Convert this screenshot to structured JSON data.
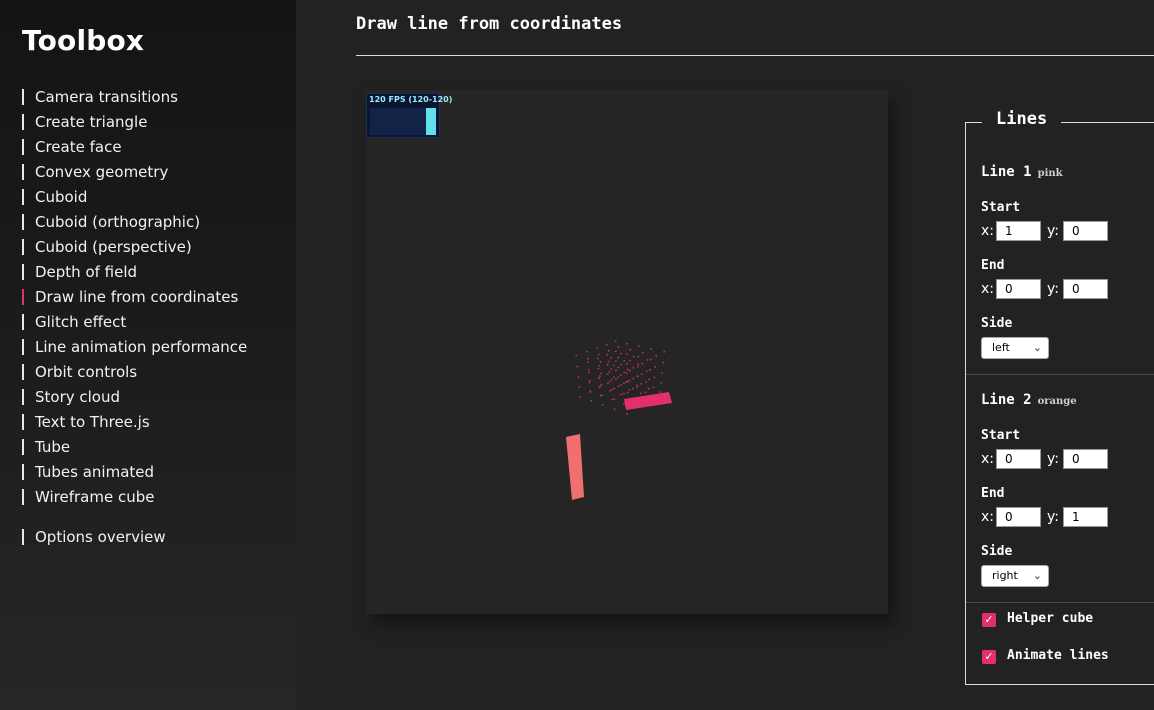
{
  "sidebar": {
    "brand": "Toolbox",
    "items": [
      {
        "label": "Camera transitions"
      },
      {
        "label": "Create triangle"
      },
      {
        "label": "Create face"
      },
      {
        "label": "Convex geometry"
      },
      {
        "label": "Cuboid"
      },
      {
        "label": "Cuboid (orthographic)"
      },
      {
        "label": "Cuboid (perspective)"
      },
      {
        "label": "Depth of field"
      },
      {
        "label": "Draw line from coordinates",
        "active": true
      },
      {
        "label": "Glitch effect"
      },
      {
        "label": "Line animation performance"
      },
      {
        "label": "Orbit controls"
      },
      {
        "label": "Story cloud"
      },
      {
        "label": "Text to Three.js"
      },
      {
        "label": "Tube"
      },
      {
        "label": "Tubes animated"
      },
      {
        "label": "Wireframe cube"
      }
    ],
    "extra": {
      "label": "Options overview"
    }
  },
  "header": {
    "title": "Draw line from coordinates"
  },
  "fps_meter": {
    "label": "120 FPS (120-120)",
    "level": 1.0
  },
  "colors": {
    "accent": "#e4306a",
    "line1": "#e4306a",
    "line2": "#f07070",
    "fps_bar": "#5fe0ea"
  },
  "panel": {
    "title": "Lines",
    "line1": {
      "heading": "Line 1",
      "tag": "pink",
      "start_label": "Start",
      "start_x_label": "x:",
      "start_x": "1",
      "start_y_label": "y:",
      "start_y": "0",
      "end_label": "End",
      "end_x_label": "x:",
      "end_x": "0",
      "end_y_label": "y:",
      "end_y": "0",
      "side_label": "Side",
      "side_value": "left"
    },
    "line2": {
      "heading": "Line 2",
      "tag": "orange",
      "start_label": "Start",
      "start_x_label": "x:",
      "start_x": "0",
      "start_y_label": "y:",
      "start_y": "0",
      "end_label": "End",
      "end_x_label": "x:",
      "end_x": "0",
      "end_y_label": "y:",
      "end_y": "1",
      "side_label": "Side",
      "side_value": "right"
    },
    "helper_cube": {
      "label": "Helper cube",
      "checked": true
    },
    "animate_lines": {
      "label": "Animate lines",
      "checked": true
    }
  }
}
